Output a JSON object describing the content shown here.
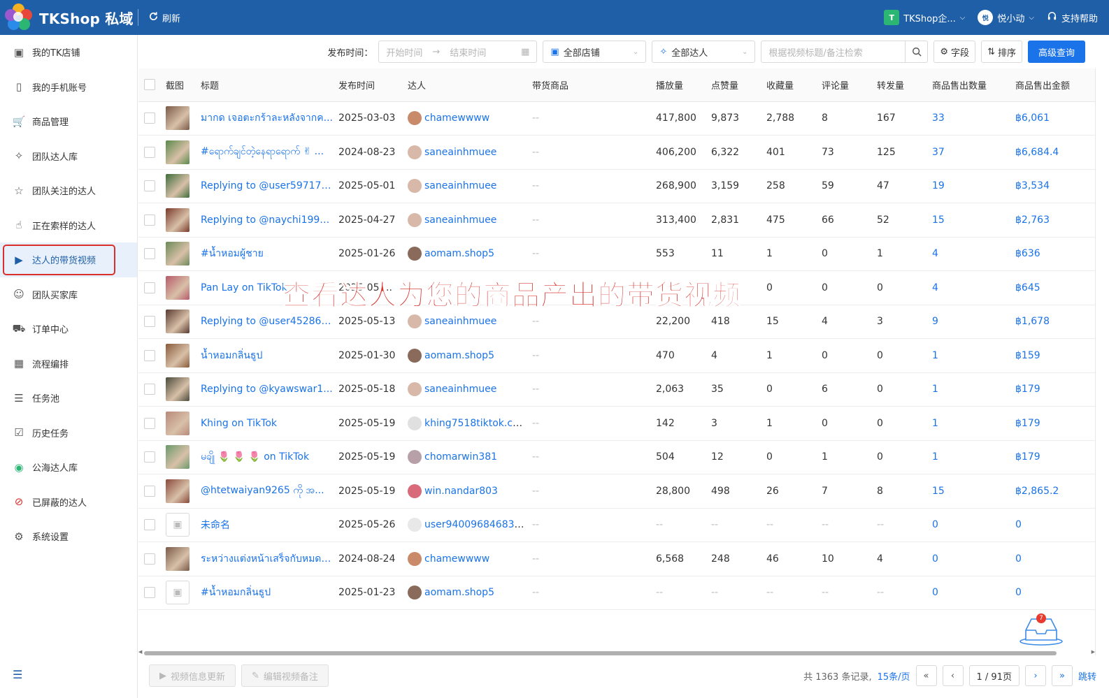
{
  "app": {
    "name": "TKShop 私域",
    "refresh_label": "刷新"
  },
  "header": {
    "org_badge": "T",
    "org_name": "TKShop企...",
    "user_avatar": "悦",
    "user_name": "悦小动",
    "help_label": "支持帮助"
  },
  "sidebar": {
    "items": [
      {
        "label": "我的TK店铺",
        "icon": "shop-icon"
      },
      {
        "label": "我的手机账号",
        "icon": "phone-icon"
      },
      {
        "label": "商品管理",
        "icon": "cart-icon"
      },
      {
        "label": "团队达人库",
        "icon": "bird-icon"
      },
      {
        "label": "团队关注的达人",
        "icon": "star-icon"
      },
      {
        "label": "正在索样的达人",
        "icon": "hand-icon"
      },
      {
        "label": "达人的带货视频",
        "icon": "video-icon",
        "active": true
      },
      {
        "label": "团队买家库",
        "icon": "user-icon"
      },
      {
        "label": "订单中心",
        "icon": "truck-icon"
      },
      {
        "label": "流程编排",
        "icon": "calendar-icon"
      },
      {
        "label": "任务池",
        "icon": "layers-icon"
      },
      {
        "label": "历史任务",
        "icon": "clipboard-icon"
      },
      {
        "label": "公海达人库",
        "icon": "public-icon"
      },
      {
        "label": "已屏蔽的达人",
        "icon": "block-icon"
      },
      {
        "label": "系统设置",
        "icon": "gear-icon"
      }
    ]
  },
  "filters": {
    "publish_label": "发布时间：",
    "start_placeholder": "开始时间",
    "end_placeholder": "结束时间",
    "shop_select": "全部店铺",
    "creator_select": "全部达人",
    "search_placeholder": "根据视频标题/备注检索",
    "fields_label": "字段",
    "sort_label": "排序",
    "advanced_label": "高级查询"
  },
  "table": {
    "headers": [
      "截图",
      "标题",
      "发布时间",
      "达人",
      "带货商品",
      "播放量",
      "点赞量",
      "收藏量",
      "评论量",
      "转发量",
      "商品售出数量",
      "商品售出金额"
    ],
    "rows": [
      {
        "thumb": "#7a5a48",
        "title": "มากด เจอตะกร้าละหลังจากค...",
        "date": "2025-03-03",
        "creator": "chamewwww",
        "av": "#c98a6a",
        "product": "--",
        "plays": "417,800",
        "likes": "9,873",
        "favs": "2,788",
        "comments": "8",
        "shares": "167",
        "sold": "33",
        "amount": "฿6,061"
      },
      {
        "thumb": "#5a8a4a",
        "title": "#ရောက်ချင်တဲ့နေရာရောက် ✌ ...",
        "date": "2024-08-23",
        "creator": "saneainhmuee",
        "av": "#d8b8a8",
        "product": "--",
        "plays": "406,200",
        "likes": "6,322",
        "favs": "401",
        "comments": "73",
        "shares": "125",
        "sold": "37",
        "amount": "฿6,684.4"
      },
      {
        "thumb": "#3e6e3a",
        "title": "Replying to @user597175...",
        "date": "2025-05-01",
        "creator": "saneainhmuee",
        "av": "#d8b8a8",
        "product": "--",
        "plays": "268,900",
        "likes": "3,159",
        "favs": "258",
        "comments": "59",
        "shares": "47",
        "sold": "19",
        "amount": "฿3,534"
      },
      {
        "thumb": "#7a3a2a",
        "title": "Replying to @naychi1994...",
        "date": "2025-04-27",
        "creator": "saneainhmuee",
        "av": "#d8b8a8",
        "product": "--",
        "plays": "313,400",
        "likes": "2,831",
        "favs": "475",
        "comments": "66",
        "shares": "52",
        "sold": "15",
        "amount": "฿2,763"
      },
      {
        "thumb": "#6b8a58",
        "title": "#น้ำหอมผู้ชาย",
        "date": "2025-01-26",
        "creator": "aomam.shop5",
        "av": "#8a6a5a",
        "product": "--",
        "plays": "553",
        "likes": "11",
        "favs": "1",
        "comments": "0",
        "shares": "1",
        "sold": "4",
        "amount": "฿636"
      },
      {
        "thumb": "#b85a6a",
        "title": "Pan Lay on TikTok",
        "date": "2025-05-...",
        "creator": "",
        "av": "",
        "product": "",
        "plays": "",
        "likes": "",
        "favs": "0",
        "comments": "0",
        "shares": "0",
        "sold": "4",
        "amount": "฿645"
      },
      {
        "thumb": "#5a3a30",
        "title": "Replying to @user452867...",
        "date": "2025-05-13",
        "creator": "saneainhmuee",
        "av": "#d8b8a8",
        "product": "--",
        "plays": "22,200",
        "likes": "418",
        "favs": "15",
        "comments": "4",
        "shares": "3",
        "sold": "9",
        "amount": "฿1,678"
      },
      {
        "thumb": "#8a5a3a",
        "title": "น้ำหอมกลิ่นธูป",
        "date": "2025-01-30",
        "creator": "aomam.shop5",
        "av": "#8a6a5a",
        "product": "--",
        "plays": "470",
        "likes": "4",
        "favs": "1",
        "comments": "0",
        "shares": "0",
        "sold": "1",
        "amount": "฿159"
      },
      {
        "thumb": "#4a4a3a",
        "title": "Replying to @kyawswar1...",
        "date": "2025-05-18",
        "creator": "saneainhmuee",
        "av": "#d8b8a8",
        "product": "--",
        "plays": "2,063",
        "likes": "35",
        "favs": "0",
        "comments": "6",
        "shares": "0",
        "sold": "1",
        "amount": "฿179"
      },
      {
        "thumb": "#b88a7a",
        "title": "Khing on TikTok",
        "date": "2025-05-19",
        "creator": "khing7518tiktok.co...",
        "av": "#e0e0e0",
        "product": "--",
        "plays": "142",
        "likes": "3",
        "favs": "1",
        "comments": "0",
        "shares": "0",
        "sold": "1",
        "amount": "฿179"
      },
      {
        "thumb": "#6a9a6a",
        "title": "မချို 🌷 🌷 🌷 on TikTok",
        "date": "2025-05-19",
        "creator": "chomarwin381",
        "av": "#b8a0a8",
        "product": "--",
        "plays": "504",
        "likes": "12",
        "favs": "0",
        "comments": "1",
        "shares": "0",
        "sold": "1",
        "amount": "฿179"
      },
      {
        "thumb": "#8a4a3a",
        "title": "@htetwaiyan9265 ကို အ...",
        "date": "2025-05-19",
        "creator": "win.nandar803",
        "av": "#d86a7a",
        "product": "--",
        "plays": "28,800",
        "likes": "498",
        "favs": "26",
        "comments": "7",
        "shares": "8",
        "sold": "15",
        "amount": "฿2,865.2"
      },
      {
        "thumb": "",
        "title": "未命名",
        "date": "2025-05-26",
        "creator": "user9400968468379",
        "av": "#e8e8e8",
        "product": "--",
        "plays": "--",
        "likes": "--",
        "favs": "--",
        "comments": "--",
        "shares": "--",
        "sold": "0",
        "amount": "0"
      },
      {
        "thumb": "#7a5a48",
        "title": "ระหว่างแต่งหน้าเสร็จกับหมดล...",
        "date": "2024-08-24",
        "creator": "chamewwww",
        "av": "#c98a6a",
        "product": "--",
        "plays": "6,568",
        "likes": "248",
        "favs": "46",
        "comments": "10",
        "shares": "4",
        "sold": "0",
        "amount": "0"
      },
      {
        "thumb": "",
        "title": "#น้ำหอมกลิ่นธูป",
        "date": "2025-01-23",
        "creator": "aomam.shop5",
        "av": "#8a6a5a",
        "product": "--",
        "plays": "--",
        "likes": "--",
        "favs": "--",
        "comments": "--",
        "shares": "--",
        "sold": "0",
        "amount": "0"
      }
    ]
  },
  "overlay": {
    "caption": "查看达人为您的商品产出的带货视频"
  },
  "footer": {
    "update_btn": "视频信息更新",
    "edit_btn": "编辑视频备注",
    "total": "共 1363 条记录,",
    "per_page": "15条/页",
    "page": "1 / 91页",
    "jump": "跳转",
    "mail_count": "7"
  }
}
